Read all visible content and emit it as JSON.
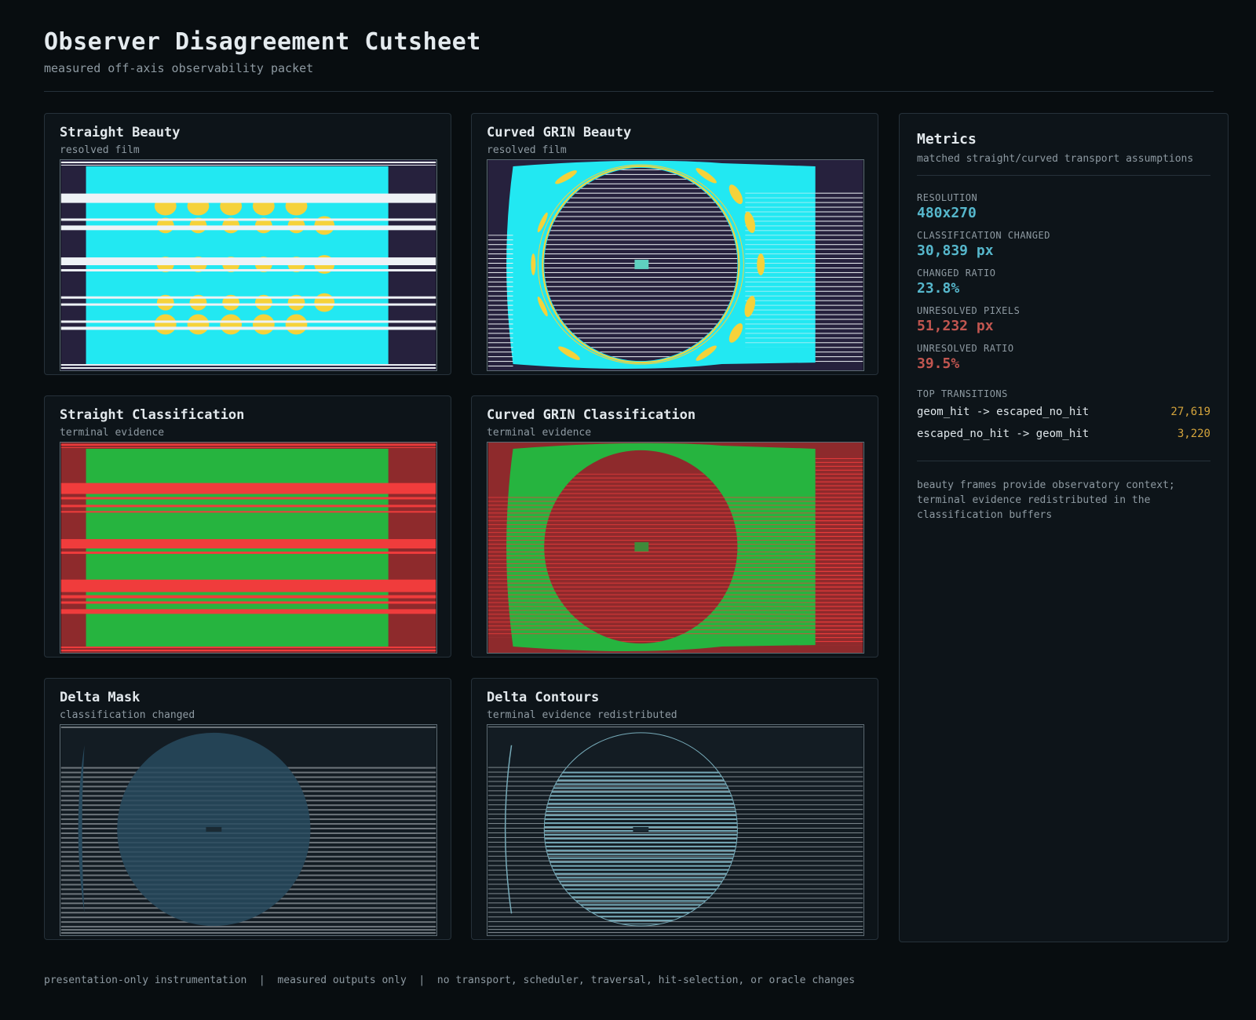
{
  "header": {
    "title": "Observer Disagreement Cutsheet",
    "subtitle": "measured off-axis observability packet"
  },
  "panels": [
    {
      "title": "Straight Beauty",
      "subtitle": "resolved film"
    },
    {
      "title": "Curved GRIN Beauty",
      "subtitle": "resolved film"
    },
    {
      "title": "Straight Classification",
      "subtitle": "terminal evidence"
    },
    {
      "title": "Curved GRIN Classification",
      "subtitle": "terminal evidence"
    },
    {
      "title": "Delta Mask",
      "subtitle": "classification changed"
    },
    {
      "title": "Delta Contours",
      "subtitle": "terminal evidence redistributed"
    }
  ],
  "metrics": {
    "title": "Metrics",
    "subtitle": "matched straight/curved transport assumptions",
    "resolution_label": "RESOLUTION",
    "resolution": "480x270",
    "changed_label": "CLASSIFICATION CHANGED",
    "changed": "30,839 px",
    "changed_ratio_label": "CHANGED RATIO",
    "changed_ratio": "23.8%",
    "unresolved_label": "UNRESOLVED PIXELS",
    "unresolved": "51,232 px",
    "unresolved_ratio_label": "UNRESOLVED RATIO",
    "unresolved_ratio": "39.5%",
    "transitions_label": "TOP TRANSITIONS",
    "transitions": [
      {
        "name": "geom_hit -> escaped_no_hit",
        "count": "27,619"
      },
      {
        "name": "escaped_no_hit -> geom_hit",
        "count": "3,220"
      }
    ],
    "note": "beauty frames provide observatory context; terminal evidence redistributed in the classification buffers"
  },
  "footer": "presentation-only instrumentation  |  measured outputs only  |  no transport, scheduler, traversal, hit-selection, or oracle changes",
  "colors": {
    "background": "#080d10",
    "panel": "#0d1419",
    "cyan": "#22e8f2",
    "navy": "#26213d",
    "yellow": "#f5d23a",
    "green": "#26b43f",
    "dark_red": "#8e2a2c",
    "bright_red": "#f03c3c",
    "teal_accent": "#56b7cc",
    "red_accent": "#c25650",
    "gold": "#d4a43c"
  }
}
